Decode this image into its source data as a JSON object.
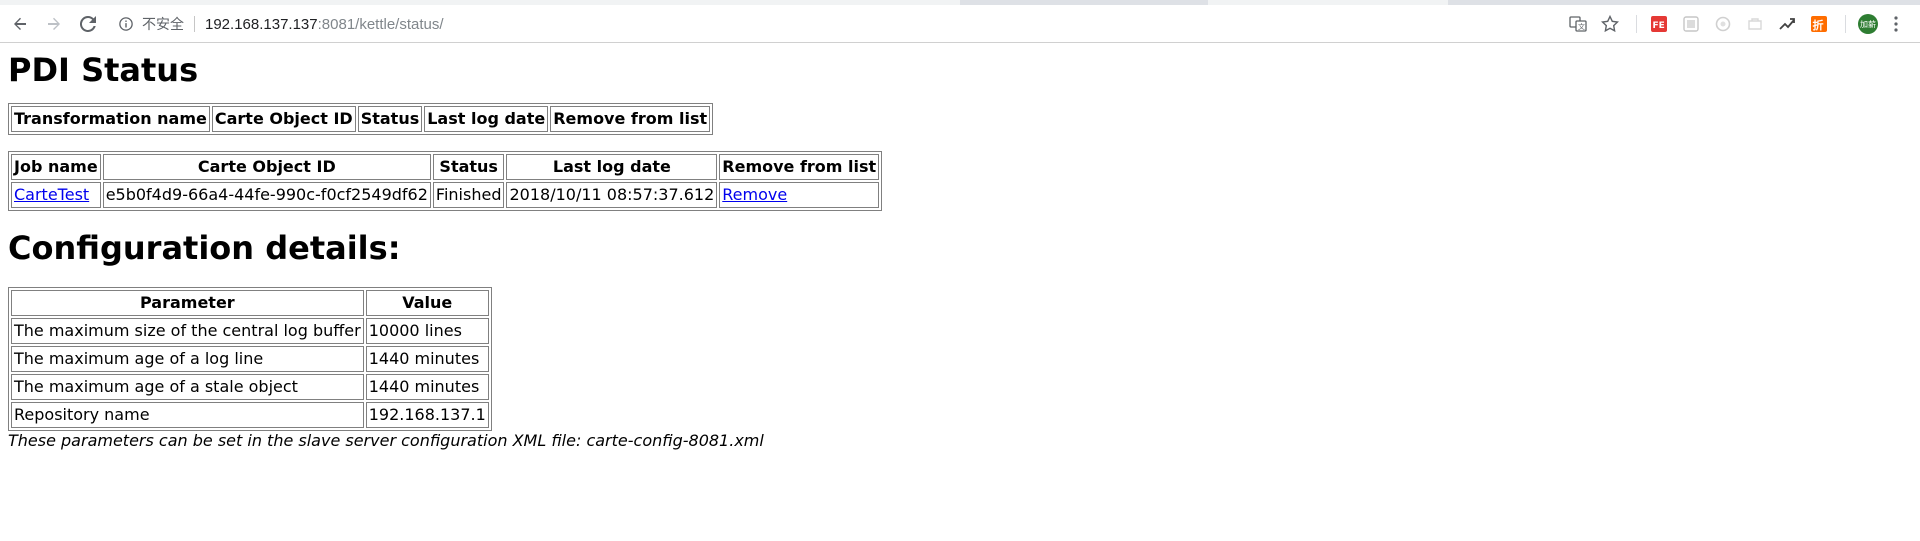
{
  "browser": {
    "security_label": "不安全",
    "url_host": "192.168.137.137",
    "url_path": ":8081/kettle/status/",
    "profile_avatar": "加薪",
    "extensions": [
      "translate-icon",
      "bookmark-star-icon",
      "fe-extension-icon",
      "extension-icon",
      "extension-icon",
      "extension-icon",
      "extension-icon",
      "discount-extension-icon"
    ]
  },
  "page": {
    "title": "PDI Status",
    "transformations": {
      "headers": [
        "Transformation name",
        "Carte Object ID",
        "Status",
        "Last log date",
        "Remove from list"
      ]
    },
    "jobs": {
      "headers": [
        "Job name",
        "Carte Object ID",
        "Status",
        "Last log date",
        "Remove from list"
      ],
      "rows": [
        {
          "name": "CarteTest",
          "id": "e5b0f4d9-66a4-44fe-990c-f0cf2549df62",
          "status": "Finished",
          "last_log": "2018/10/11 08:57:37.612",
          "remove": "Remove"
        }
      ]
    },
    "config_title": "Configuration details:",
    "config": {
      "headers": [
        "Parameter",
        "Value"
      ],
      "rows": [
        {
          "param": "The maximum size of the central log buffer",
          "value": "10000 lines"
        },
        {
          "param": "The maximum age of a log line",
          "value": "1440 minutes"
        },
        {
          "param": "The maximum age of a stale object",
          "value": "1440 minutes"
        },
        {
          "param": "Repository name",
          "value": "192.168.137.1"
        }
      ]
    },
    "note": "These parameters can be set in the slave server configuration XML file: carte-config-8081.xml"
  }
}
